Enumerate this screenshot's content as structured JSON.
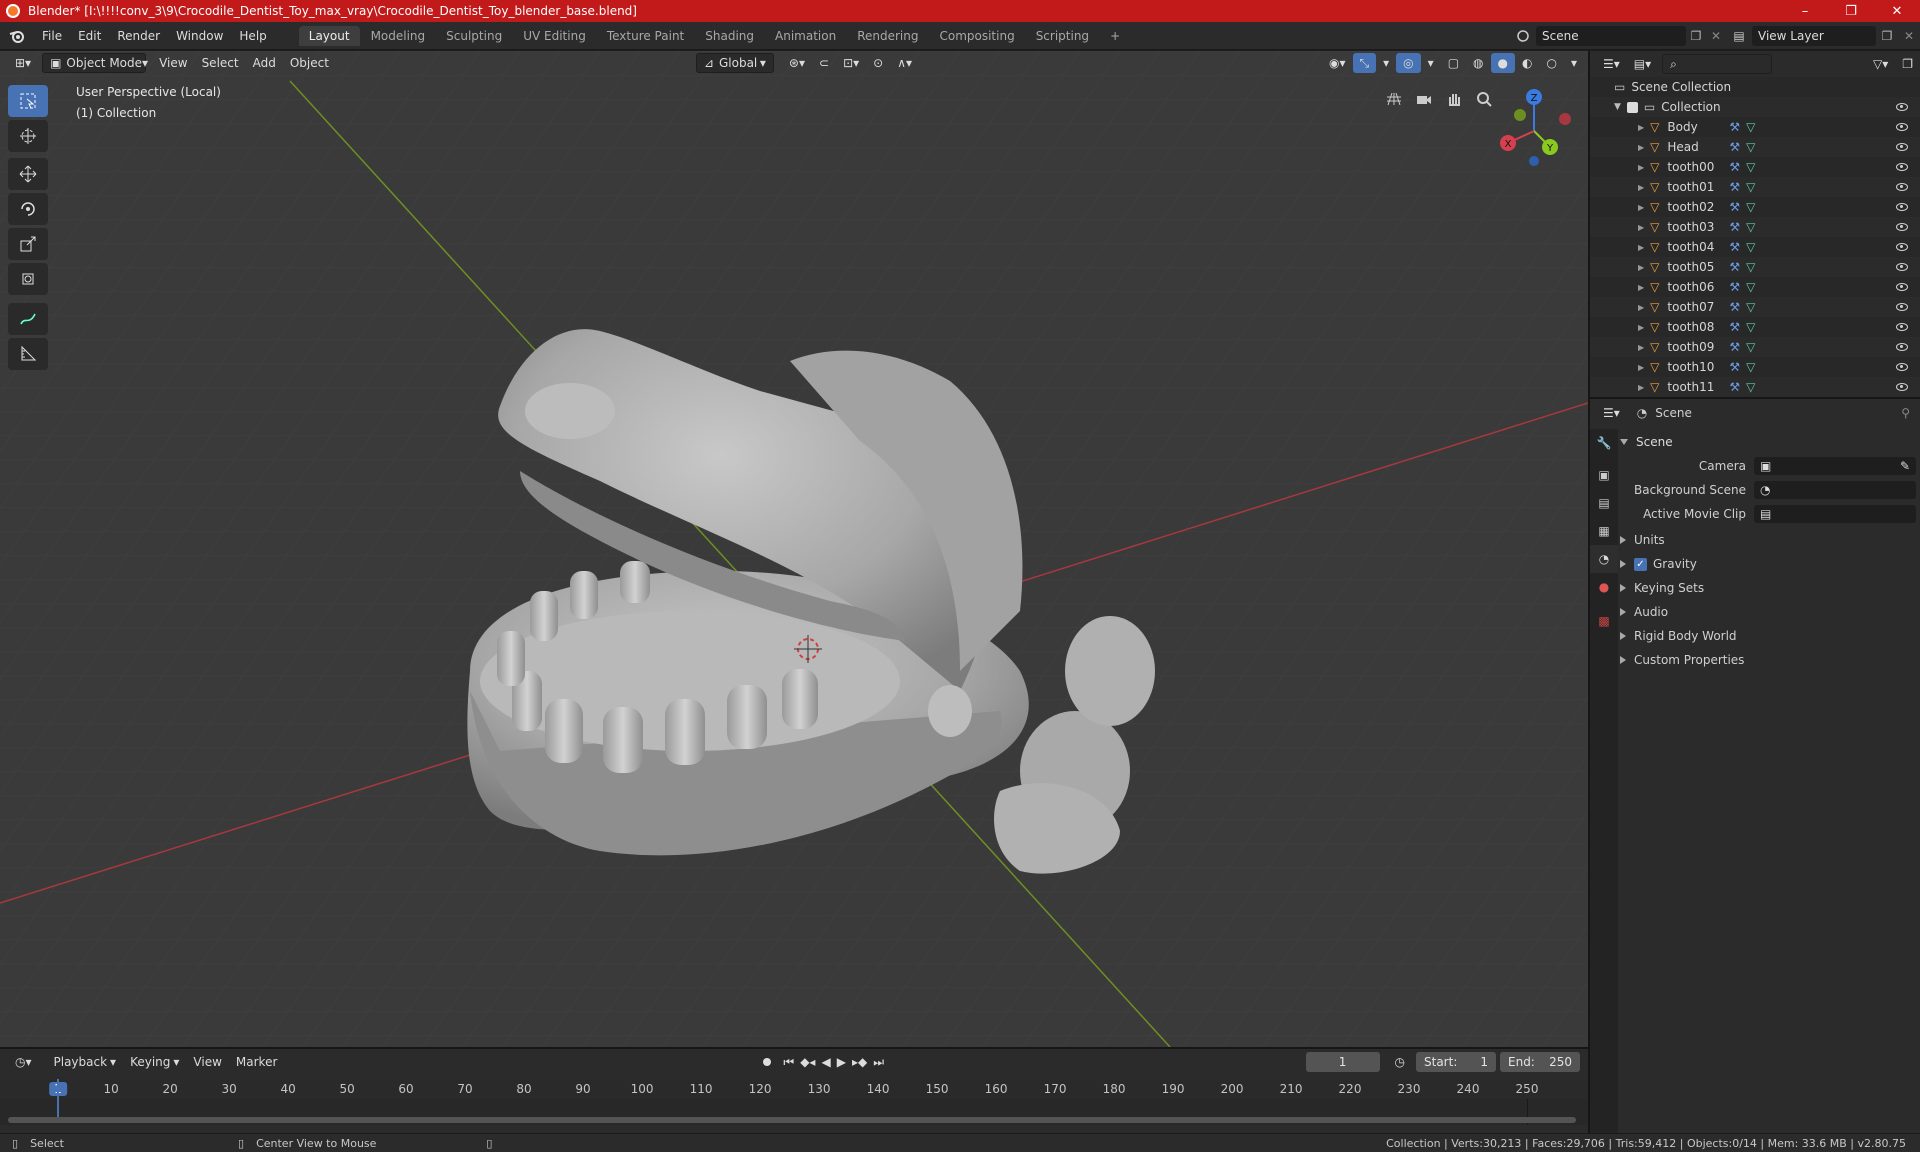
{
  "window": {
    "title": "Blender* [I:\\!!!!conv_3\\9\\Crocodile_Dentist_Toy_max_vray\\Crocodile_Dentist_Toy_blender_base.blend]",
    "minimize": "–",
    "maximize": "❐",
    "close": "✕"
  },
  "menu": [
    "File",
    "Edit",
    "Render",
    "Window",
    "Help"
  ],
  "workspaces": [
    "Layout",
    "Modeling",
    "Sculpting",
    "UV Editing",
    "Texture Paint",
    "Shading",
    "Animation",
    "Rendering",
    "Compositing",
    "Scripting"
  ],
  "active_workspace": "Layout",
  "add_workspace": "+",
  "scene_field": "Scene",
  "view_layer_field": "View Layer",
  "viewport": {
    "mode": "Object Mode",
    "menus": [
      "View",
      "Select",
      "Add",
      "Object"
    ],
    "orientation": "Global",
    "info_line1": "User Perspective (Local)",
    "info_line2": "(1) Collection",
    "gizmo": {
      "x": "X",
      "y": "Y",
      "z": "Z"
    }
  },
  "outliner": {
    "root": "Scene Collection",
    "collection": "Collection",
    "objects": [
      "Body",
      "Head",
      "tooth00",
      "tooth01",
      "tooth02",
      "tooth03",
      "tooth04",
      "tooth05",
      "tooth06",
      "tooth07",
      "tooth08",
      "tooth09",
      "tooth10",
      "tooth11"
    ]
  },
  "properties": {
    "header": "Scene",
    "panel": "Scene",
    "fields": [
      {
        "label": "Camera"
      },
      {
        "label": "Background Scene"
      },
      {
        "label": "Active Movie Clip"
      }
    ],
    "subpanels": [
      "Units",
      "Gravity",
      "Keying Sets",
      "Audio",
      "Rigid Body World",
      "Custom Properties"
    ],
    "gravity_checked": true
  },
  "timeline": {
    "menus": [
      "Playback",
      "Keying",
      "View",
      "Marker"
    ],
    "current_frame": "1",
    "start_label": "Start:",
    "start": "1",
    "end_label": "End:",
    "end": "250",
    "ticks": [
      "1",
      "10",
      "20",
      "30",
      "40",
      "50",
      "60",
      "70",
      "80",
      "90",
      "100",
      "110",
      "120",
      "130",
      "140",
      "150",
      "160",
      "170",
      "180",
      "190",
      "200",
      "210",
      "220",
      "230",
      "240",
      "250"
    ]
  },
  "statusbar": {
    "left": "Select",
    "middle": "Center View to Mouse",
    "right": "Collection | Verts:30,213 | Faces:29,706 | Tris:59,412 | Objects:0/14 | Mem: 33.6 MB | v2.80.75"
  },
  "colors": {
    "title_bar": "#c21a1a",
    "accent_blue": "#4772b3",
    "x_axis": "#d6404e",
    "y_axis": "#8bc91f",
    "z_axis": "#3b7ae0",
    "object_orange": "#f19c3d",
    "mesh_green": "#56d0a4"
  }
}
